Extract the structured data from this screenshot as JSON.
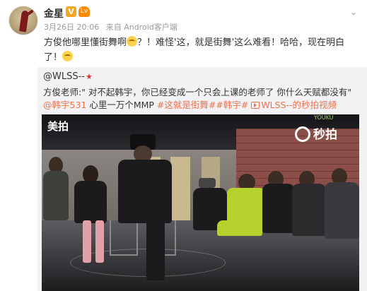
{
  "post": {
    "author": "金星",
    "verified_badge": "V",
    "level_badge": "Lv",
    "timestamp": "3月26日 20:06",
    "source": "来自 Android客户端",
    "text_before_emoji": "方俊他哪里懂街舞啊",
    "text_after_emoji": "？！难怪'这，就是街舞'这么难看！哈哈，现在明白了！",
    "more_icon": "chevron-down-icon"
  },
  "repost": {
    "username": "@WLSS--",
    "star": "★",
    "text_part1": "方俊老师:\" 对不起韩宇，你已经变成一个只会上课的老师了 你什么天赋都没有\" ",
    "mention": "@韩宇531",
    "text_part2": " 心里一万个MMP ",
    "hashtag1": "#这就是街舞#",
    "hashtag2": "#韩宇#",
    "video_link": "WLSS--的秒拍视频"
  },
  "video": {
    "watermark_left": "美拍",
    "watermark_youku": "YOUKU",
    "watermark_right": "秒拍"
  },
  "colors": {
    "link": "#eb7350",
    "badge_verified": "#f5a623",
    "repost_bg": "#f2f2f5"
  }
}
